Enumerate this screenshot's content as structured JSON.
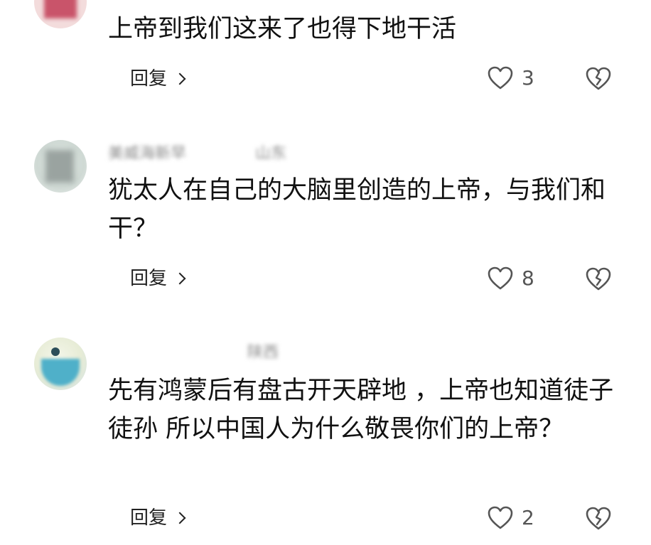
{
  "comments": [
    {
      "author": "",
      "location": "",
      "text": "上帝到我们这来了也得下地干活",
      "reply_label": "回复",
      "like_count": "3"
    },
    {
      "author": "美威海新早",
      "location": "山东",
      "text": "犹太人在自己的大脑里创造的上帝，与我们和干？",
      "reply_label": "回复",
      "like_count": "8"
    },
    {
      "author": "",
      "location": "陕西",
      "text": "先有鸿蒙后有盘古开天辟地 ，上帝也知道徒子徒孙 所以中国人为什么敬畏你们的上帝？",
      "reply_label": "回复",
      "like_count": "2"
    }
  ],
  "icons": {
    "like": "heart-outline-icon",
    "dislike": "broken-heart-outline-icon",
    "reply_arrow": "chevron-right-icon"
  },
  "colors": {
    "text": "#111111",
    "muted": "#555555",
    "icon_stroke": "#555555"
  }
}
